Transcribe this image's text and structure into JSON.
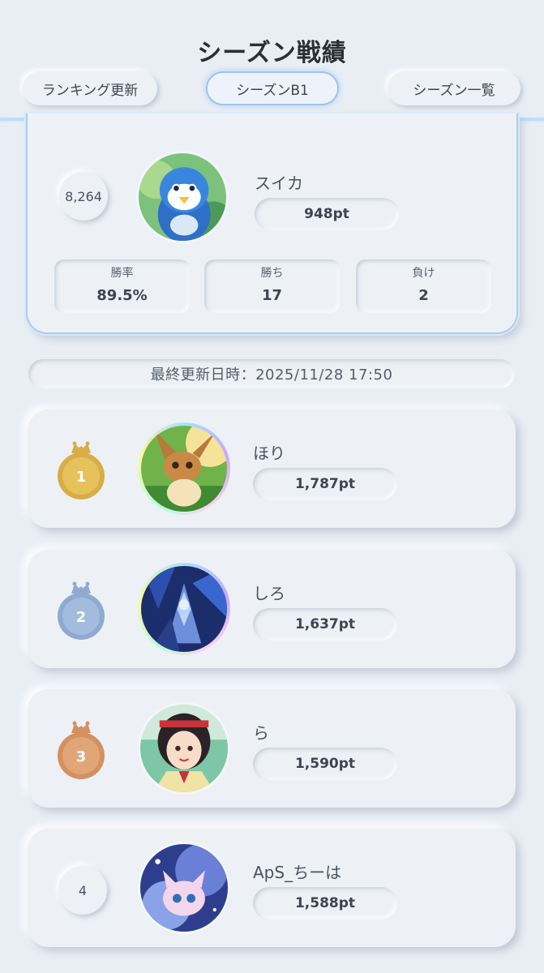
{
  "header": {
    "title": "シーズン戦績",
    "tabs": [
      {
        "label": "ランキング更新"
      },
      {
        "label": "シーズンB1"
      },
      {
        "label": "シーズン一覧"
      }
    ]
  },
  "my_record": {
    "rank": "8,264",
    "name": "スイカ",
    "points": "948pt",
    "stats": [
      {
        "label": "勝率",
        "value": "89.5%"
      },
      {
        "label": "勝ち",
        "value": "17"
      },
      {
        "label": "負け",
        "value": "2"
      }
    ]
  },
  "last_updated": "最終更新日時：2025/11/28 17:50",
  "ranking": [
    {
      "rank": "1",
      "name": "ほり",
      "points": "1,787pt",
      "medal": "gold",
      "medal_color": "#d8ad45"
    },
    {
      "rank": "2",
      "name": "しろ",
      "points": "1,637pt",
      "medal": "silver-blue",
      "medal_color": "#8fa9d0"
    },
    {
      "rank": "3",
      "name": "ら",
      "points": "1,590pt",
      "medal": "bronze",
      "medal_color": "#d4915f"
    },
    {
      "rank": "4",
      "name": "ApS_ちーは",
      "points": "1,588pt"
    }
  ],
  "colors": {
    "background": "#e9eef5",
    "accent_blue": "#7fc2f4"
  }
}
